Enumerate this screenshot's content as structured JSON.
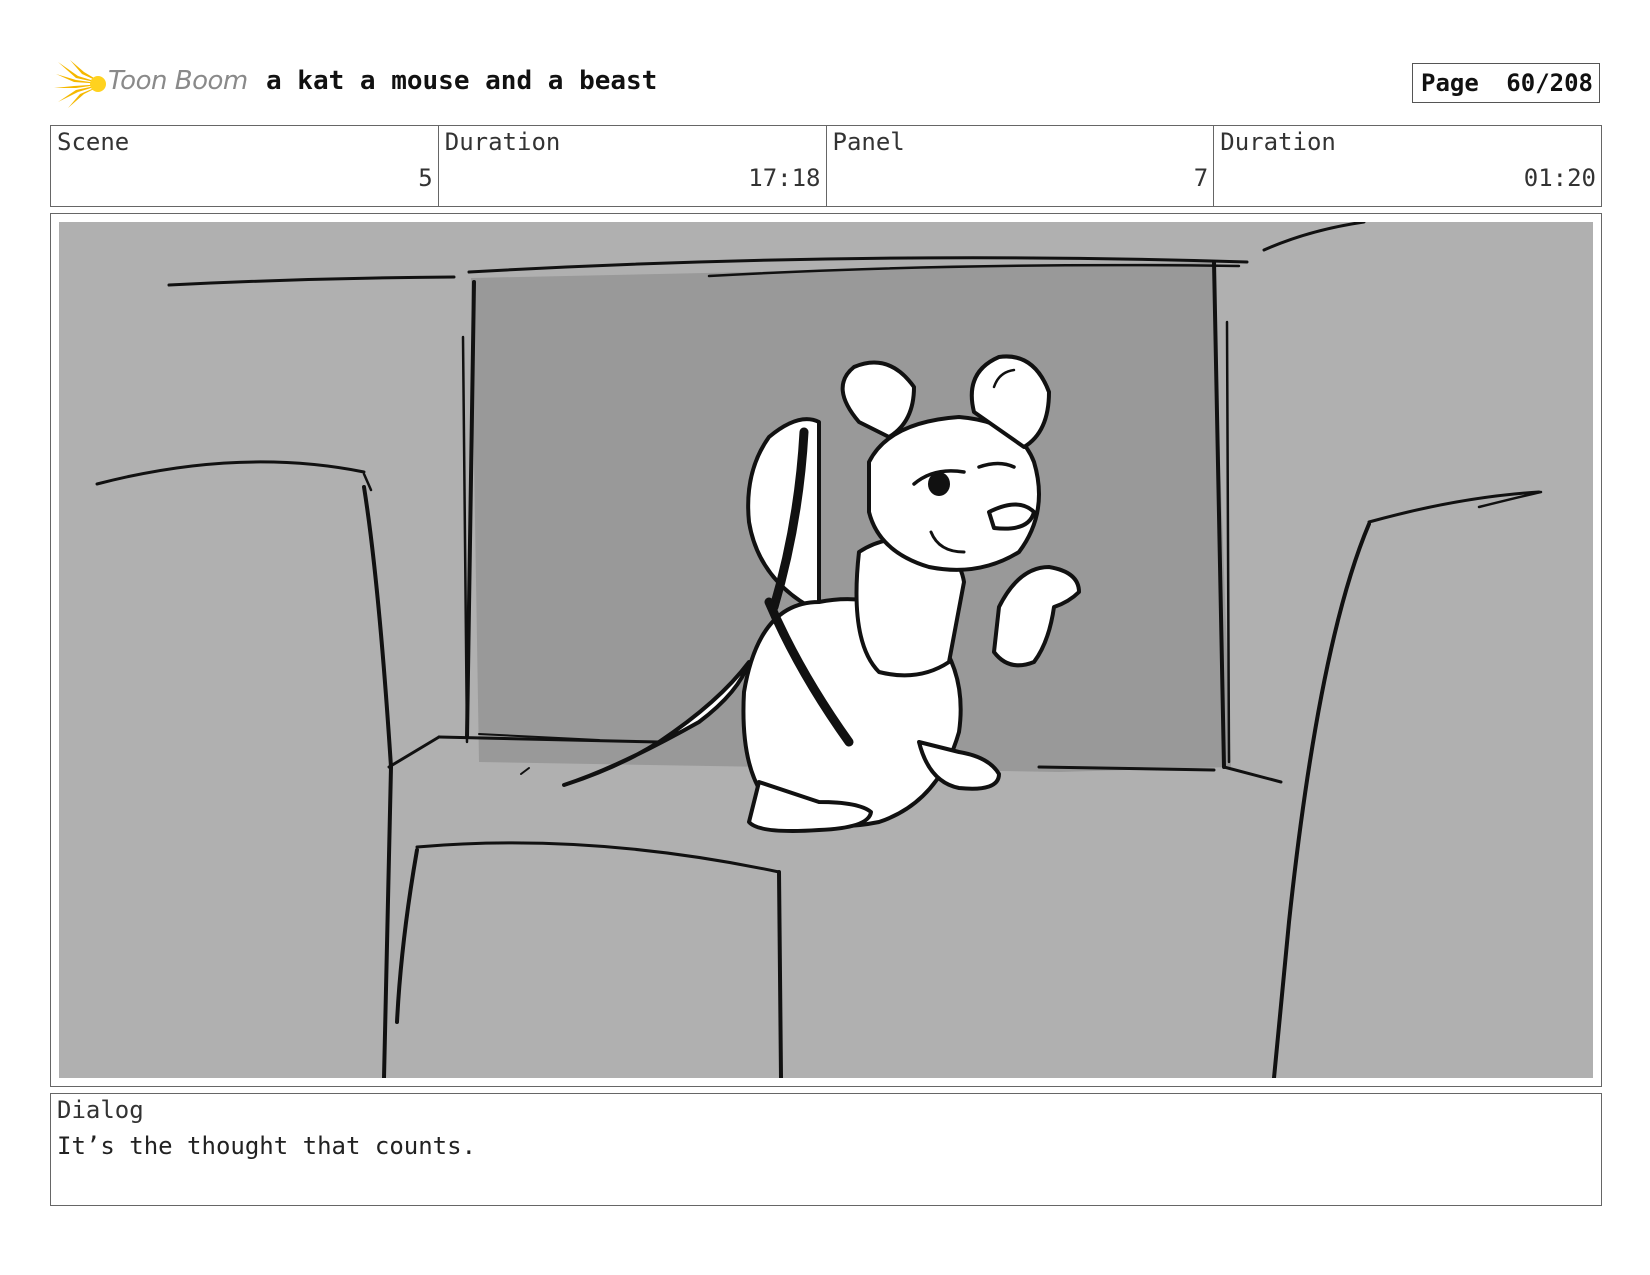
{
  "header": {
    "brand": "Toon Boom",
    "project_title": "a kat a mouse and a beast",
    "page_label": "Page",
    "page_value": "60/208"
  },
  "info": {
    "scene_label": "Scene",
    "scene_value": "5",
    "scene_duration_label": "Duration",
    "scene_duration_value": "17:18",
    "panel_label": "Panel",
    "panel_value": "7",
    "panel_duration_label": "Duration",
    "panel_duration_value": "01:20"
  },
  "dialog": {
    "label": "Dialog",
    "text": "It’s the thought that counts."
  },
  "colors": {
    "logo_star": "#f5b800",
    "panel_bg": "#b0b0b0",
    "back_wall": "#999999",
    "ink": "#111111"
  }
}
